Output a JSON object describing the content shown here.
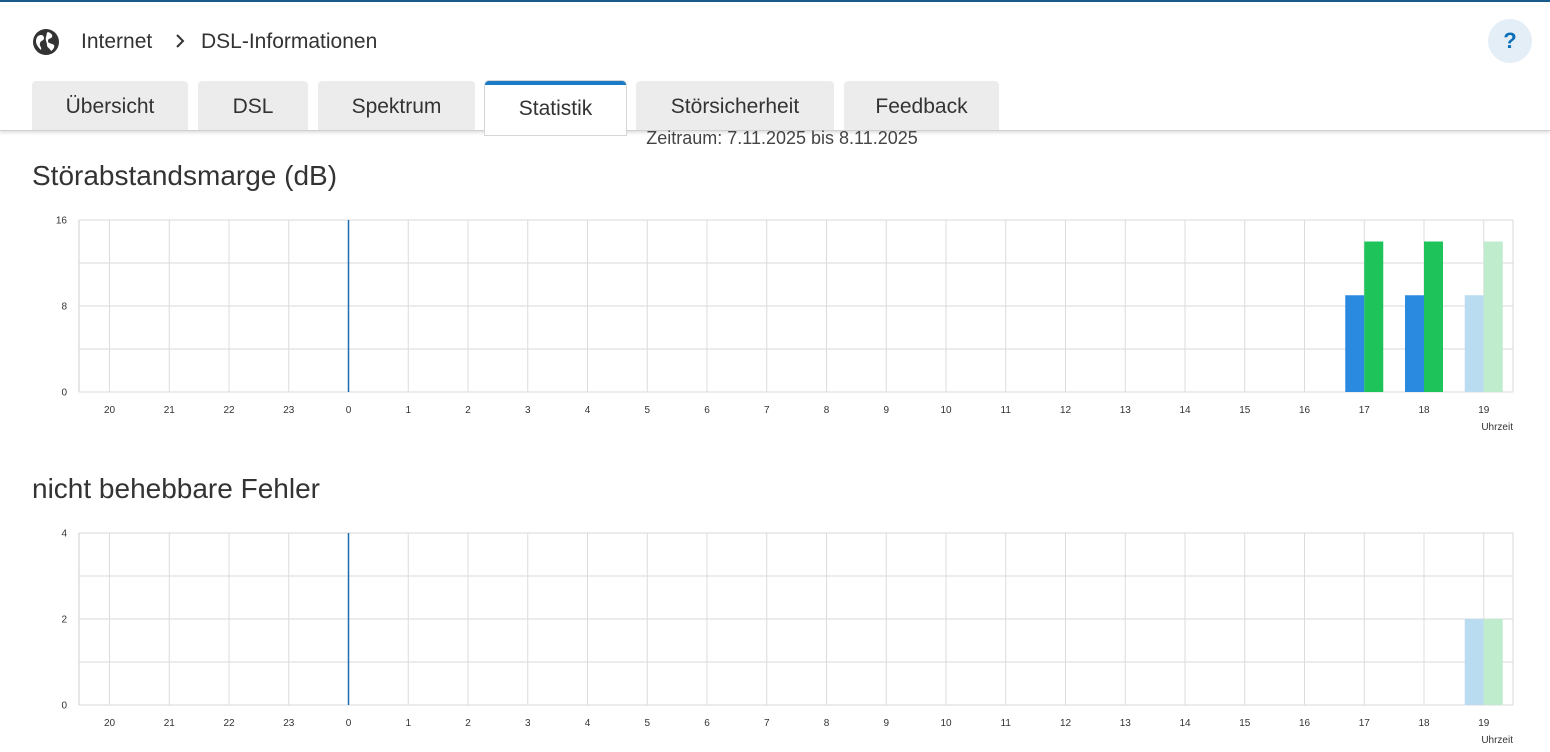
{
  "breadcrumb": {
    "icon": "globe-icon",
    "items": [
      "Internet",
      "DSL-Informationen"
    ]
  },
  "help_label": "?",
  "tabs": [
    {
      "label": "Übersicht",
      "active": false
    },
    {
      "label": "DSL",
      "active": false
    },
    {
      "label": "Spektrum",
      "active": false
    },
    {
      "label": "Statistik",
      "active": true
    },
    {
      "label": "Störsicherheit",
      "active": false
    },
    {
      "label": "Feedback",
      "active": false
    }
  ],
  "period": "Zeitraum: 7.11.2025 bis 8.11.2025",
  "colors": {
    "blue": "#2a8ae0",
    "green": "#1ec45a",
    "blue_light": "#b9dcf1",
    "green_light": "#bfeccd",
    "marker": "#1a6cb0",
    "accent": "#1a7cc8"
  },
  "chart_data": [
    {
      "type": "bar",
      "title": "Störabstandsmarge (dB)",
      "xlabel": "Uhrzeit",
      "ylabel": "",
      "ylim": [
        0,
        16
      ],
      "yticks": [
        0,
        8,
        16
      ],
      "categories": [
        "20",
        "21",
        "22",
        "23",
        "0",
        "1",
        "2",
        "3",
        "4",
        "5",
        "6",
        "7",
        "8",
        "9",
        "10",
        "11",
        "12",
        "13",
        "14",
        "15",
        "16",
        "17",
        "18",
        "19"
      ],
      "marker_category": "0",
      "grid": true,
      "series": [
        {
          "color_key": "blue",
          "values": [
            0,
            0,
            0,
            0,
            0,
            0,
            0,
            0,
            0,
            0,
            0,
            0,
            0,
            0,
            0,
            0,
            0,
            0,
            0,
            0,
            0,
            9,
            9,
            9
          ]
        },
        {
          "color_key": "green",
          "values": [
            0,
            0,
            0,
            0,
            0,
            0,
            0,
            0,
            0,
            0,
            0,
            0,
            0,
            0,
            0,
            0,
            0,
            0,
            0,
            0,
            0,
            14,
            14,
            14
          ]
        }
      ],
      "light_categories": [
        "19"
      ]
    },
    {
      "type": "bar",
      "title": "nicht behebbare Fehler",
      "xlabel": "Uhrzeit",
      "ylabel": "",
      "ylim": [
        0,
        4
      ],
      "yticks": [
        0,
        2,
        4
      ],
      "categories": [
        "20",
        "21",
        "22",
        "23",
        "0",
        "1",
        "2",
        "3",
        "4",
        "5",
        "6",
        "7",
        "8",
        "9",
        "10",
        "11",
        "12",
        "13",
        "14",
        "15",
        "16",
        "17",
        "18",
        "19"
      ],
      "marker_category": "0",
      "grid": true,
      "series": [
        {
          "color_key": "blue",
          "values": [
            0,
            0,
            0,
            0,
            0,
            0,
            0,
            0,
            0,
            0,
            0,
            0,
            0,
            0,
            0,
            0,
            0,
            0,
            0,
            0,
            0,
            0,
            0,
            2
          ]
        },
        {
          "color_key": "green",
          "values": [
            0,
            0,
            0,
            0,
            0,
            0,
            0,
            0,
            0,
            0,
            0,
            0,
            0,
            0,
            0,
            0,
            0,
            0,
            0,
            0,
            0,
            0,
            0,
            2
          ]
        }
      ],
      "light_categories": [
        "19"
      ]
    }
  ]
}
